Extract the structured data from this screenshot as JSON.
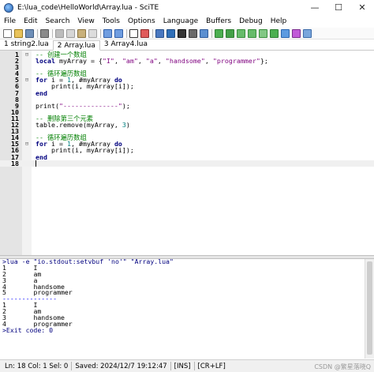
{
  "window": {
    "title": "E:\\lua_code\\HelloWorld\\Array.lua - SciTE",
    "minimize": "—",
    "maximize": "☐",
    "close": "✕"
  },
  "menu": [
    "File",
    "Edit",
    "Search",
    "View",
    "Tools",
    "Options",
    "Language",
    "Buffers",
    "Debug",
    "Help"
  ],
  "toolbar": [
    {
      "name": "new-file-icon",
      "color": "#ffffff",
      "border": "#6c6c6c"
    },
    {
      "name": "open-folder-icon",
      "color": "#e8c25a",
      "border": "#9c7a1f"
    },
    {
      "name": "save-icon",
      "color": "#6f8fb8",
      "border": "#3e5a80"
    },
    {
      "sep": true
    },
    {
      "name": "print-icon",
      "color": "#8a8a8a",
      "border": "#555555"
    },
    {
      "sep": true
    },
    {
      "name": "cut-icon",
      "color": "#bcbcbc",
      "border": "#9a9a9a"
    },
    {
      "name": "copy-icon",
      "color": "#d6d6d6",
      "border": "#9a9a9a"
    },
    {
      "name": "paste-icon",
      "color": "#c8b07a",
      "border": "#8a7440"
    },
    {
      "name": "delete-icon",
      "color": "#dcdcdc",
      "border": "#a0a0a0"
    },
    {
      "sep": true
    },
    {
      "name": "undo-icon",
      "color": "#6f9de0",
      "border": "#2f5ea8"
    },
    {
      "name": "redo-icon",
      "color": "#6f9de0",
      "border": "#2f5ea8"
    },
    {
      "sep": true
    },
    {
      "name": "find-icon",
      "color": "#ffffff",
      "border": "#333333"
    },
    {
      "name": "replace-icon",
      "color": "#e05a5a",
      "border": "#8a2a2a"
    },
    {
      "sep": true
    },
    {
      "name": "compile-icon",
      "color": "#4a78c0",
      "border": "#28508a"
    },
    {
      "name": "build-icon",
      "color": "#2f6fb8",
      "border": "#1b4a80"
    },
    {
      "name": "go-icon",
      "color": "#333333",
      "border": "#111111"
    },
    {
      "name": "stop-icon",
      "color": "#6a6a6a",
      "border": "#3a3a3a"
    },
    {
      "name": "output-pane-icon",
      "color": "#5b8fd0",
      "border": "#2d5a99"
    },
    {
      "sep": true
    },
    {
      "name": "next-message-icon",
      "color": "#4caf50",
      "border": "#2e7d32"
    },
    {
      "name": "prev-message-icon",
      "color": "#43a047",
      "border": "#2e7d32"
    },
    {
      "name": "bookmark-next-icon",
      "color": "#66bb6a",
      "border": "#388e3c"
    },
    {
      "name": "bookmark-prev-icon",
      "color": "#66bb6a",
      "border": "#388e3c"
    },
    {
      "name": "toggle-bookmark-icon",
      "color": "#81c784",
      "border": "#388e3c"
    },
    {
      "name": "clear-bookmarks-icon",
      "color": "#4caf50",
      "border": "#2e7d32"
    },
    {
      "name": "fold-all-icon",
      "color": "#5c9be0",
      "border": "#2a64ad"
    },
    {
      "name": "expand-all-icon",
      "color": "#c15ad8",
      "border": "#7a2c8c"
    },
    {
      "name": "tab-list-icon",
      "color": "#7aa6dc",
      "border": "#3a6aa8"
    }
  ],
  "tabs": [
    {
      "label": "1 string2.lua",
      "active": false
    },
    {
      "label": "2 Array.lua",
      "active": true
    },
    {
      "label": "3 Array4.lua",
      "active": false
    }
  ],
  "editor": {
    "current_line": 18,
    "lines": [
      {
        "n": "1",
        "fold": "⊟",
        "parts": [
          [
            "cmt",
            "-- 创建一个数组"
          ]
        ]
      },
      {
        "n": "2",
        "fold": "",
        "parts": [
          [
            "kw",
            "local"
          ],
          [
            "",
            " myArray = {"
          ],
          [
            "str",
            "\"I\""
          ],
          [
            "",
            ", "
          ],
          [
            "str",
            "\"am\""
          ],
          [
            "",
            ", "
          ],
          [
            "str",
            "\"a\""
          ],
          [
            "",
            ", "
          ],
          [
            "str",
            "\"handsome\""
          ],
          [
            "",
            ", "
          ],
          [
            "str",
            "\"programmer\""
          ],
          [
            "",
            "};"
          ]
        ]
      },
      {
        "n": "3",
        "fold": "",
        "parts": []
      },
      {
        "n": "4",
        "fold": "",
        "parts": [
          [
            "cmt",
            "-- 循环遍历数组"
          ]
        ]
      },
      {
        "n": "5",
        "fold": "⊟",
        "parts": [
          [
            "kw",
            "for"
          ],
          [
            "",
            " i = "
          ],
          [
            "num",
            "1"
          ],
          [
            "",
            ", #myArray "
          ],
          [
            "kw",
            "do"
          ]
        ]
      },
      {
        "n": "6",
        "fold": "",
        "parts": [
          [
            "",
            "    print(i, myArray[i]);"
          ]
        ]
      },
      {
        "n": "7",
        "fold": "",
        "parts": [
          [
            "kw",
            "end"
          ]
        ]
      },
      {
        "n": "8",
        "fold": "",
        "parts": []
      },
      {
        "n": "9",
        "fold": "",
        "parts": [
          [
            "",
            "print("
          ],
          [
            "str",
            "\"--------------\""
          ],
          [
            "",
            ");"
          ]
        ]
      },
      {
        "n": "10",
        "fold": "",
        "parts": []
      },
      {
        "n": "11",
        "fold": "",
        "parts": [
          [
            "cmt",
            "-- 删除第三个元素"
          ]
        ]
      },
      {
        "n": "12",
        "fold": "",
        "parts": [
          [
            "",
            "table.remove(myArray, "
          ],
          [
            "num",
            "3"
          ],
          [
            "",
            ")"
          ]
        ]
      },
      {
        "n": "13",
        "fold": "",
        "parts": []
      },
      {
        "n": "14",
        "fold": "",
        "parts": [
          [
            "cmt",
            "-- 循环遍历数组"
          ]
        ]
      },
      {
        "n": "15",
        "fold": "⊟",
        "parts": [
          [
            "kw",
            "for"
          ],
          [
            "",
            " i = "
          ],
          [
            "num",
            "1"
          ],
          [
            "",
            ", #myArray "
          ],
          [
            "kw",
            "do"
          ]
        ]
      },
      {
        "n": "16",
        "fold": "",
        "parts": [
          [
            "",
            "    print(i, myArray[i]);"
          ]
        ]
      },
      {
        "n": "17",
        "fold": "",
        "parts": [
          [
            "kw",
            "end"
          ]
        ]
      },
      {
        "n": "18",
        "fold": "",
        "parts": []
      }
    ]
  },
  "output": [
    {
      "cls": "cmd",
      "text": ">lua -e \"io.stdout:setvbuf 'no'\" \"Array.lua\""
    },
    {
      "cls": "",
      "text": "1\tI"
    },
    {
      "cls": "",
      "text": "2\tam"
    },
    {
      "cls": "",
      "text": "3\ta"
    },
    {
      "cls": "",
      "text": "4\thandsome"
    },
    {
      "cls": "",
      "text": "5\tprogrammer"
    },
    {
      "cls": "sep",
      "text": "--------------"
    },
    {
      "cls": "",
      "text": "1\tI"
    },
    {
      "cls": "",
      "text": "2\tam"
    },
    {
      "cls": "",
      "text": "3\thandsome"
    },
    {
      "cls": "",
      "text": "4\tprogrammer"
    },
    {
      "cls": "exit",
      "text": ">Exit code: 0"
    }
  ],
  "status": {
    "position": "Ln: 18 Col: 1 Sel: 0",
    "saved": "Saved: 2024/12/7  19:12:47",
    "mode": "[INS]",
    "eol": "[CR+LF]",
    "watermark": "CSDN @繁星落晓Q"
  }
}
